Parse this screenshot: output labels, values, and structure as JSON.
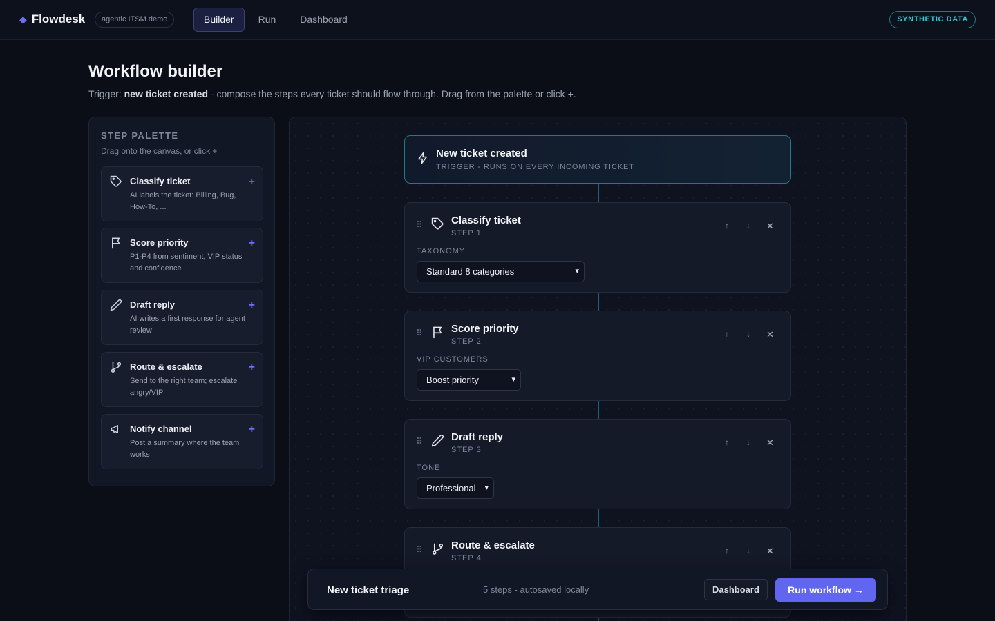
{
  "app": {
    "brand_mark": "◆",
    "name": "Flowdesk",
    "badge": "agentic ITSM demo",
    "synthetic_label": "SYNTHETIC DATA"
  },
  "nav": {
    "tabs": [
      {
        "label": "Builder",
        "active": true
      },
      {
        "label": "Run",
        "active": false
      },
      {
        "label": "Dashboard",
        "active": false
      }
    ]
  },
  "page": {
    "title": "Workflow builder",
    "subtitle_prefix": "Trigger: ",
    "subtitle_trigger": "new ticket created",
    "subtitle_rest": " - compose the steps every ticket should flow through. Drag from the palette or click +."
  },
  "palette": {
    "title": "STEP PALETTE",
    "hint": "Drag onto the canvas, or click +",
    "add_symbol": "+",
    "items": [
      {
        "name": "Classify ticket",
        "desc": "AI labels the ticket: Billing, Bug, How-To, ...",
        "icon": "tag-icon"
      },
      {
        "name": "Score priority",
        "desc": "P1-P4 from sentiment, VIP status and confidence",
        "icon": "flag-icon"
      },
      {
        "name": "Draft reply",
        "desc": "AI writes a first response for agent review",
        "icon": "pencil-icon"
      },
      {
        "name": "Route & escalate",
        "desc": "Send to the right team; escalate angry/VIP",
        "icon": "branch-icon"
      },
      {
        "name": "Notify channel",
        "desc": "Post a summary where the team works",
        "icon": "megaphone-icon"
      }
    ]
  },
  "canvas": {
    "trigger": {
      "title": "New ticket created",
      "subtitle": "TRIGGER - RUNS ON EVERY INCOMING TICKET",
      "icon": "lightning-icon"
    },
    "controls": {
      "up": "↑",
      "down": "↓",
      "remove": "✕",
      "drag": "⠿"
    },
    "steps": [
      {
        "title": "Classify ticket",
        "step": "STEP 1",
        "field_label": "TAXONOMY",
        "value": "Standard 8 categories",
        "icon": "tag-icon"
      },
      {
        "title": "Score priority",
        "step": "STEP 2",
        "field_label": "VIP CUSTOMERS",
        "value": "Boost priority",
        "icon": "flag-icon"
      },
      {
        "title": "Draft reply",
        "step": "STEP 3",
        "field_label": "TONE",
        "value": "Professional",
        "icon": "pencil-icon"
      },
      {
        "title": "Route & escalate",
        "step": "STEP 4",
        "icon": "branch-icon"
      }
    ]
  },
  "bottom_bar": {
    "workflow_name": "New ticket triage",
    "status": "5 steps - autosaved locally",
    "dashboard_button": "Dashboard",
    "run_button": "Run workflow →"
  },
  "colors": {
    "accent": "#6166f0",
    "teal": "#37c4d4",
    "background": "#0b0e17"
  }
}
